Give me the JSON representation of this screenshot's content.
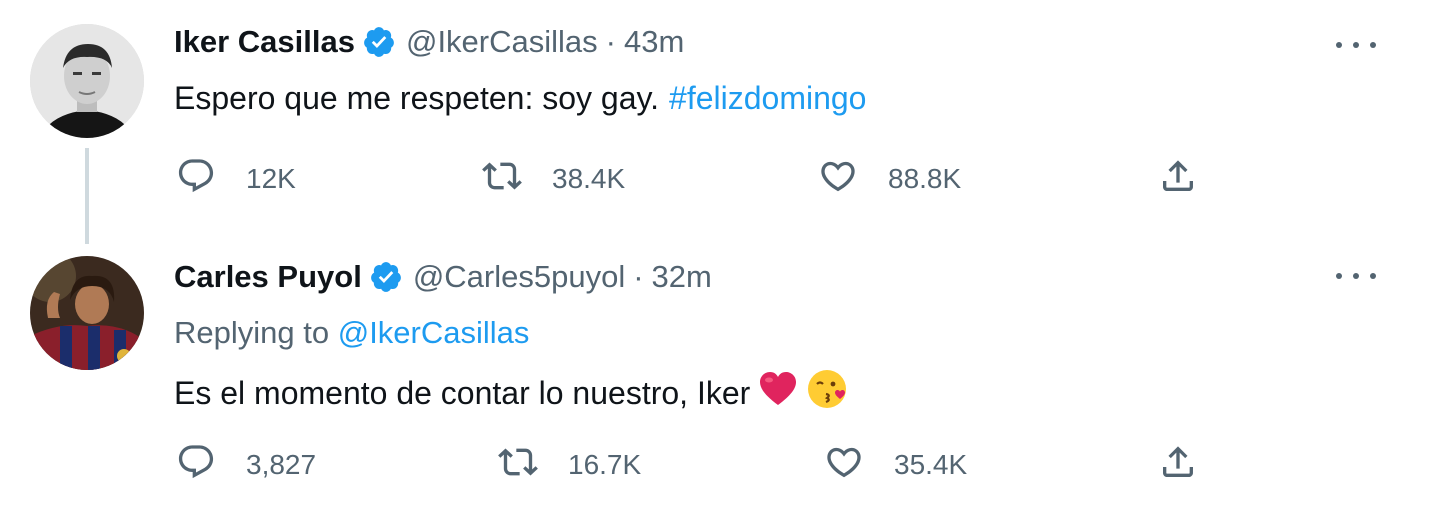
{
  "tweets": [
    {
      "author": {
        "name": "Iker Casillas",
        "handle": "@IkerCasillas"
      },
      "separator": "·",
      "time": "43m",
      "text": "Espero que me respeten: soy gay.",
      "hashtag": "#felizdomingo",
      "stats": {
        "replies": "12K",
        "retweets": "38.4K",
        "likes": "88.8K"
      }
    },
    {
      "author": {
        "name": "Carles Puyol",
        "handle": "@Carles5puyol"
      },
      "separator": "·",
      "time": "32m",
      "replying_label": "Replying to",
      "replying_handle": "@IkerCasillas",
      "text": "Es el momento de contar lo nuestro, Iker",
      "emojis": [
        "red-heart",
        "kissing-face-with-heart"
      ],
      "stats": {
        "replies": "3,827",
        "retweets": "16.7K",
        "likes": "35.4K"
      }
    }
  ],
  "icons": {
    "verified": "verified-badge-icon",
    "more": "more-icon",
    "reply": "reply-icon",
    "retweet": "retweet-icon",
    "like": "like-icon",
    "share": "share-icon"
  },
  "colors": {
    "accent": "#1d9bf0",
    "secondary_text": "#536471",
    "primary_text": "#0f1419",
    "thread_line": "#cfd9de",
    "heart": "#e0245e"
  }
}
